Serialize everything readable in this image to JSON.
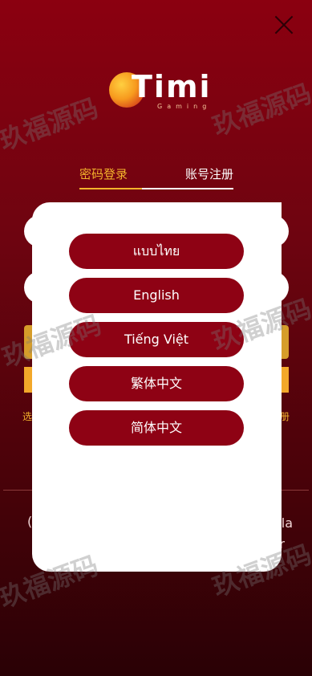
{
  "header": {
    "close_icon": "close-icon"
  },
  "logo": {
    "brand": "Timi",
    "sub": "Gaming"
  },
  "tabs": [
    {
      "label": "密码登录"
    },
    {
      "label": "账号注册"
    }
  ],
  "background": {
    "left_text": "选",
    "right_text": "册",
    "frag_right": "la",
    "frag_right2": "r",
    "frag_left": "("
  },
  "languages": [
    {
      "label": "แบบไทย"
    },
    {
      "label": "English"
    },
    {
      "label": "Tiếng Việt"
    },
    {
      "label": "繁体中文"
    },
    {
      "label": "简体中文"
    }
  ],
  "watermark": {
    "text": "玖福源码"
  },
  "colors": {
    "accent": "#f3b32c",
    "button": "#8e0214",
    "background_top": "#8b0010",
    "background_bottom": "#2a0105"
  }
}
